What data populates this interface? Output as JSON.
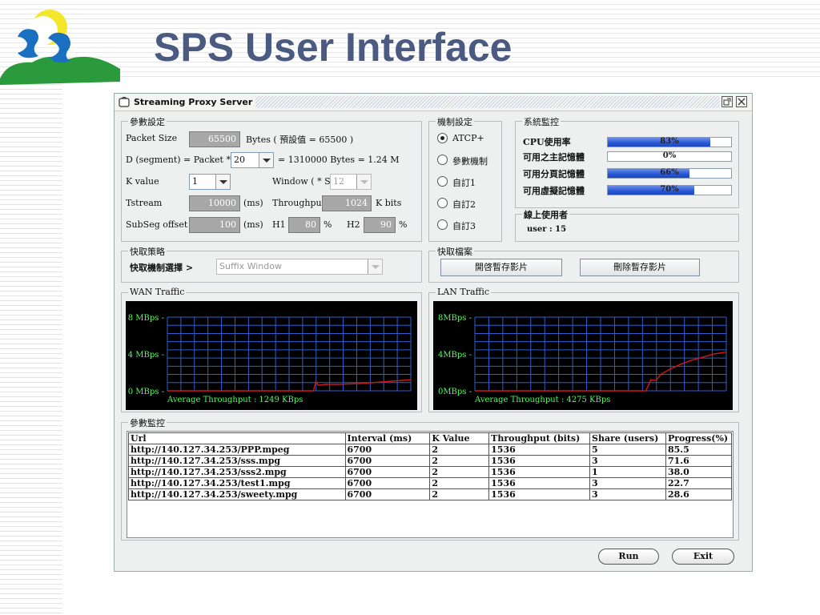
{
  "slide": {
    "title": "SPS User Interface"
  },
  "window": {
    "title": "Streaming Proxy Server"
  },
  "params": {
    "group_title": "參數設定",
    "packet_size_label": "Packet Size",
    "packet_size_value": "65500",
    "packet_size_note": "Bytes ( 預設值 = 65500 )",
    "d_segment_label": "D (segment)  =  Packet  *",
    "d_segment_value": "20",
    "d_segment_note": "= 1310000 Bytes = 1.24 M",
    "k_value_label": "K value",
    "k_value_value": "1",
    "window_label": "Window ( * S )",
    "window_value": "12",
    "tstream_label": "Tstream",
    "tstream_value": "10000",
    "tstream_unit": "(ms)",
    "throughput_label": "Throughput",
    "throughput_value": "1024",
    "throughput_unit": "K bits",
    "subseg_label": "SubSeg offset",
    "subseg_value": "100",
    "subseg_unit": "(ms)",
    "h1_label": "H1",
    "h1_value": "80",
    "h1_unit": "%",
    "h2_label": "H2",
    "h2_value": "90",
    "h2_unit": "%"
  },
  "mechanism": {
    "group_title": "機制設定",
    "options": [
      "ATCP+",
      "參數機制",
      "自訂1",
      "自訂2",
      "自訂3"
    ],
    "selected": "ATCP+"
  },
  "monitor": {
    "group_title": "系統監控",
    "rows": [
      {
        "label": "CPU使用率",
        "percent": 83,
        "text": "83%"
      },
      {
        "label": "可用之主記憶體",
        "percent": 0,
        "text": "0%"
      },
      {
        "label": "可用分頁記憶體",
        "percent": 66,
        "text": "66%"
      },
      {
        "label": "可用虛擬記憶體",
        "percent": 70,
        "text": "70%"
      }
    ],
    "online_title": "線上使用者",
    "online_text": "user : 15"
  },
  "cache_policy": {
    "group_title": "快取策略",
    "select_label": "快取機制選擇 >",
    "select_value": "Suffix Window"
  },
  "cache_files": {
    "group_title": "快取檔案",
    "open_button": "開啓暫存影片",
    "delete_button": "刪除暫存影片"
  },
  "wan": {
    "group_title": "WAN Traffic",
    "avg_text": "Average Throughput : 1249 KBps"
  },
  "lan": {
    "group_title": "LAN Traffic",
    "avg_text": "Average Throughput : 4275 KBps"
  },
  "chart_data": [
    {
      "type": "line",
      "title": "WAN Traffic",
      "yticks": [
        "8 MBps",
        "4 MBps",
        "0 MBps"
      ],
      "ylim": [
        0,
        8
      ],
      "grid": true,
      "x": [
        0,
        10,
        20,
        30,
        40,
        50,
        55,
        60,
        61,
        62,
        65,
        70,
        80,
        90,
        100
      ],
      "y": [
        0,
        0,
        0,
        0,
        0,
        0,
        0,
        0,
        1.0,
        0.6,
        0.7,
        0.7,
        0.8,
        1.0,
        1.2
      ]
    },
    {
      "type": "line",
      "title": "LAN Traffic",
      "yticks": [
        "8MBps",
        "4MBps",
        "0MBps"
      ],
      "ylim": [
        0,
        8
      ],
      "grid": true,
      "x": [
        0,
        10,
        20,
        30,
        40,
        50,
        60,
        68,
        70,
        72,
        74,
        78,
        82,
        86,
        90,
        95,
        100
      ],
      "y": [
        0,
        0,
        0,
        0,
        0,
        0,
        0,
        0,
        1.2,
        1.1,
        1.8,
        2.4,
        2.9,
        3.3,
        3.6,
        4.0,
        4.2
      ]
    }
  ],
  "param_monitor": {
    "group_title": "參數監控",
    "columns": [
      "Url",
      "Interval (ms)",
      "K Value",
      "Throughput (bits)",
      "Share (users)",
      "Progress(%)"
    ],
    "rows": [
      [
        "http://140.127.34.253/PPP.mpeg",
        "6700",
        "2",
        "1536",
        "5",
        "85.5"
      ],
      [
        "http://140.127.34.253/sss.mpg",
        "6700",
        "2",
        "1536",
        "3",
        "71.6"
      ],
      [
        "http://140.127.34.253/sss2.mpg",
        "6700",
        "2",
        "1536",
        "1",
        "38.0"
      ],
      [
        "http://140.127.34.253/test1.mpg",
        "6700",
        "2",
        "1536",
        "3",
        "22.7"
      ],
      [
        "http://140.127.34.253/sweety.mpg",
        "6700",
        "2",
        "1536",
        "3",
        "28.6"
      ]
    ]
  },
  "actions": {
    "run": "Run",
    "exit": "Exit"
  }
}
